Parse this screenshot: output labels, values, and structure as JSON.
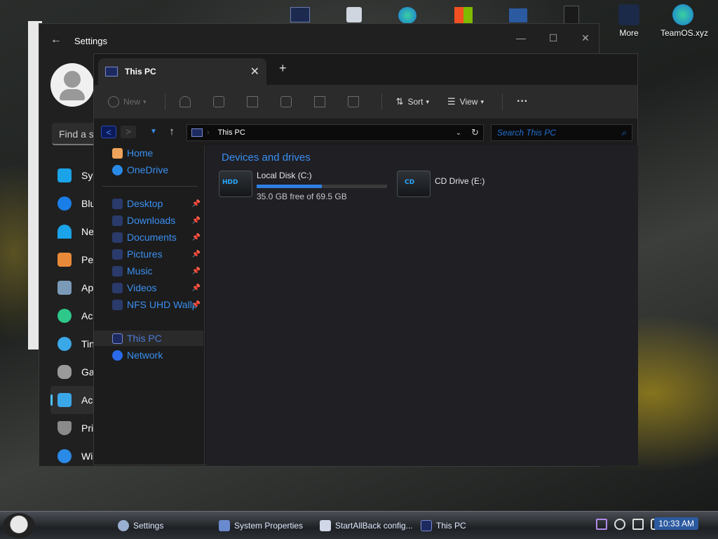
{
  "desktop": {
    "icons": [
      {
        "label": "More"
      },
      {
        "label": "TeamOS.xyz"
      }
    ]
  },
  "settings_window": {
    "title": "Settings",
    "search_placeholder": "Find a se",
    "nav": [
      {
        "label": "Sys",
        "icon": "system-icon",
        "color": "#1aa3e8"
      },
      {
        "label": "Blu",
        "icon": "bluetooth-icon",
        "color": "#1a7ee8"
      },
      {
        "label": "Ne",
        "icon": "wifi-icon",
        "color": "#1aa3e8"
      },
      {
        "label": "Per",
        "icon": "brush-icon",
        "color": "#e88a3a"
      },
      {
        "label": "Ap",
        "icon": "apps-icon",
        "color": "#7a9ab8"
      },
      {
        "label": "Acc",
        "icon": "accounts-icon",
        "color": "#2ec88a"
      },
      {
        "label": "Tin",
        "icon": "time-icon",
        "color": "#3aa8e8"
      },
      {
        "label": "Ga",
        "icon": "gaming-icon",
        "color": "#9a9a9a"
      },
      {
        "label": "Acc",
        "icon": "accessibility-icon",
        "color": "#3aa8e8"
      },
      {
        "label": "Priv",
        "icon": "shield-icon",
        "color": "#8a8a8a"
      },
      {
        "label": "Wi",
        "icon": "windows-update-icon",
        "color": "#2a8ae8"
      }
    ]
  },
  "explorer": {
    "tab_title": "This PC",
    "toolbar": {
      "new": "New",
      "sort": "Sort",
      "view": "View",
      "more": "···"
    },
    "address": "This PC",
    "search_placeholder": "Search This PC",
    "nav": {
      "home": "Home",
      "onedrive": "OneDrive",
      "desktop": "Desktop",
      "downloads": "Downloads",
      "documents": "Documents",
      "pictures": "Pictures",
      "music": "Music",
      "videos": "Videos",
      "nfs": "NFS UHD Wallp",
      "thispc": "This PC",
      "network": "Network"
    },
    "section_title": "Devices and drives",
    "drives": [
      {
        "name": "Local Disk (C:)",
        "badge": "HDD",
        "free_text": "35.0 GB free of 69.5 GB",
        "used_fraction": 0.5
      },
      {
        "name": "CD Drive (E:)",
        "badge": "CD"
      }
    ]
  },
  "taskbar": {
    "items": [
      {
        "label": "Settings"
      },
      {
        "label": "System Properties"
      },
      {
        "label": "StartAllBack config..."
      },
      {
        "label": "This PC"
      }
    ],
    "clock": "10:33 AM"
  }
}
